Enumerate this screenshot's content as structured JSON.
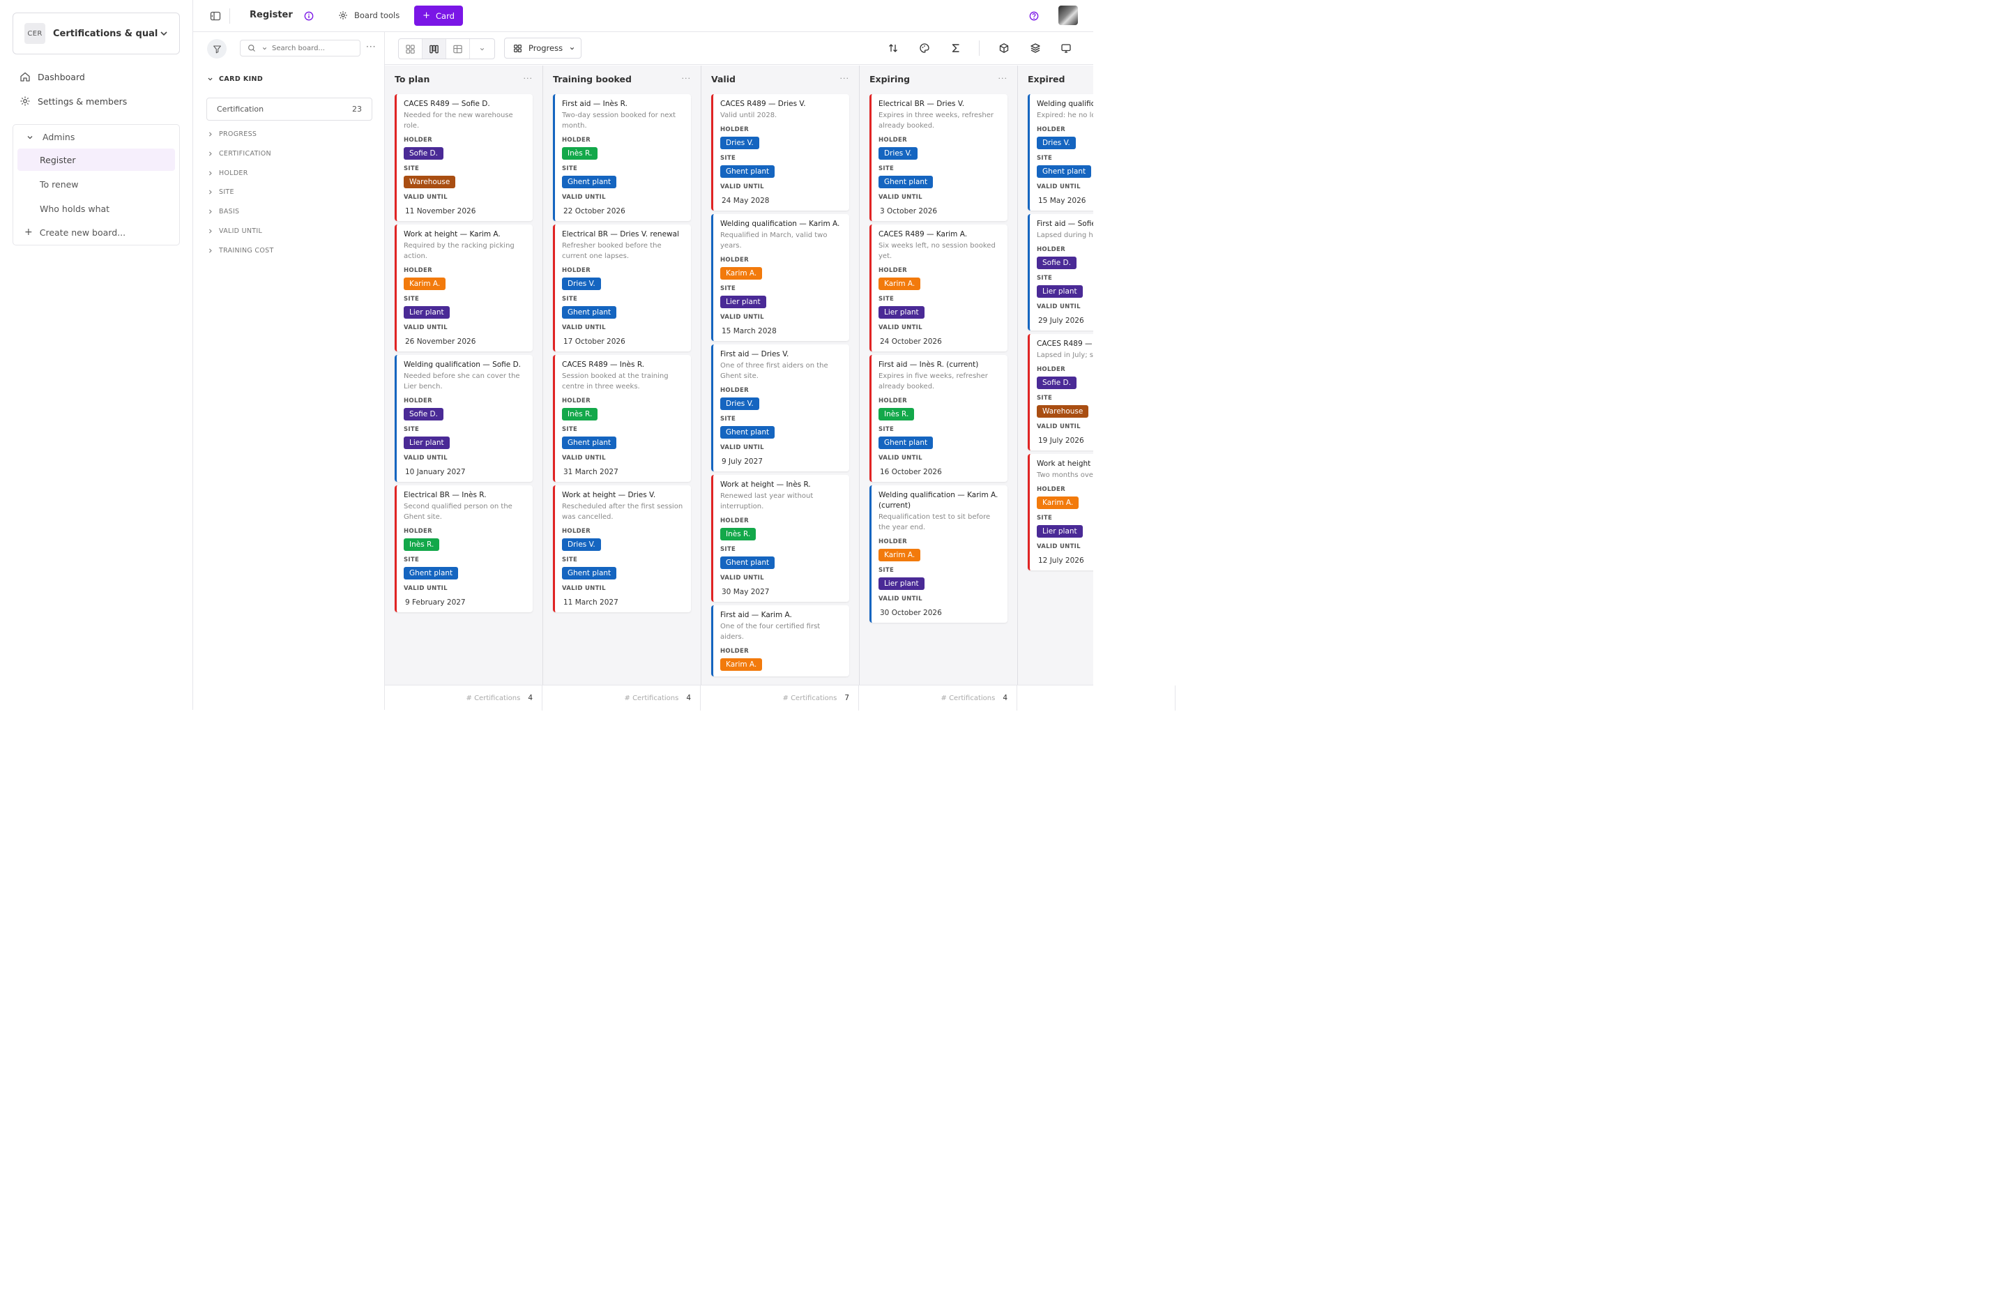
{
  "workspace": {
    "badge": "CER",
    "name": "Certifications & quali..."
  },
  "nav": {
    "dashboard": "Dashboard",
    "settings": "Settings & members"
  },
  "boards": {
    "group": "Admins",
    "items": [
      "Register",
      "To renew",
      "Who holds what"
    ],
    "create": "Create new board..."
  },
  "topbar": {
    "title": "Register",
    "board_tools": "Board tools",
    "card_button": "Card"
  },
  "filter": {
    "search_placeholder": "Search board...",
    "card_kind": "CARD KIND",
    "kind_value": "Certification",
    "kind_count": "23",
    "groups": [
      "PROGRESS",
      "CERTIFICATION",
      "HOLDER",
      "SITE",
      "BASIS",
      "VALID UNTIL",
      "TRAINING COST"
    ]
  },
  "view": {
    "group_by": "Progress"
  },
  "labels": {
    "holder": "HOLDER",
    "site": "SITE",
    "valid_until": "VALID UNTIL"
  },
  "colors": {
    "accent": "#7a16e6",
    "stripe_red": "#e02424",
    "stripe_blue": "#1565c0"
  },
  "columns": [
    {
      "title": "To plan",
      "footer_label": "# Certifications",
      "footer_count": "4",
      "cards": [
        {
          "title": "CACES R489 — Sofie D.",
          "desc": "Needed for the new warehouse role.",
          "holder": "Sofie D.",
          "site": "Warehouse",
          "valid_until": "11 November 2026",
          "stripe": "red"
        },
        {
          "title": "Work at height — Karim A.",
          "desc": "Required by the racking picking action.",
          "holder": "Karim A.",
          "site": "Lier plant",
          "valid_until": "26 November 2026",
          "stripe": "red"
        },
        {
          "title": "Welding qualification — Sofie D.",
          "desc": "Needed before she can cover the Lier bench.",
          "holder": "Sofie D.",
          "site": "Lier plant",
          "valid_until": "10 January 2027",
          "stripe": "blue"
        },
        {
          "title": "Electrical BR — Inès R.",
          "desc": "Second qualified person on the Ghent site.",
          "holder": "Inès R.",
          "site": "Ghent plant",
          "valid_until": "9 February 2027",
          "stripe": "red"
        }
      ]
    },
    {
      "title": "Training booked",
      "footer_label": "# Certifications",
      "footer_count": "4",
      "cards": [
        {
          "title": "First aid — Inès R.",
          "desc": "Two-day session booked for next month.",
          "holder": "Inès R.",
          "site": "Ghent plant",
          "valid_until": "22 October 2026",
          "stripe": "blue"
        },
        {
          "title": "Electrical BR — Dries V. renewal",
          "desc": "Refresher booked before the current one lapses.",
          "holder": "Dries V.",
          "site": "Ghent plant",
          "valid_until": "17 October 2026",
          "stripe": "red"
        },
        {
          "title": "CACES R489 — Inès R.",
          "desc": "Session booked at the training centre in three weeks.",
          "holder": "Inès R.",
          "site": "Ghent plant",
          "valid_until": "31 March 2027",
          "stripe": "red"
        },
        {
          "title": "Work at height — Dries V.",
          "desc": "Rescheduled after the first session was cancelled.",
          "holder": "Dries V.",
          "site": "Ghent plant",
          "valid_until": "11 March 2027",
          "stripe": "red"
        }
      ]
    },
    {
      "title": "Valid",
      "footer_label": "# Certifications",
      "footer_count": "7",
      "cards": [
        {
          "title": "CACES R489 — Dries V.",
          "desc": "Valid until 2028.",
          "holder": "Dries V.",
          "site": "Ghent plant",
          "valid_until": "24 May 2028",
          "stripe": "red"
        },
        {
          "title": "Welding qualification — Karim A.",
          "desc": "Requalified in March, valid two years.",
          "holder": "Karim A.",
          "site": "Lier plant",
          "valid_until": "15 March 2028",
          "stripe": "blue"
        },
        {
          "title": "First aid — Dries V.",
          "desc": "One of three first aiders on the Ghent site.",
          "holder": "Dries V.",
          "site": "Ghent plant",
          "valid_until": "9 July 2027",
          "stripe": "blue"
        },
        {
          "title": "Work at height — Inès R.",
          "desc": "Renewed last year without interruption.",
          "holder": "Inès R.",
          "site": "Ghent plant",
          "valid_until": "30 May 2027",
          "stripe": "red"
        },
        {
          "title": "First aid — Karim A.",
          "desc": "One of the four certified first aiders.",
          "holder": "Karim A.",
          "site": "",
          "valid_until": "",
          "stripe": "blue"
        }
      ]
    },
    {
      "title": "Expiring",
      "footer_label": "# Certifications",
      "footer_count": "4",
      "cards": [
        {
          "title": "Electrical BR — Dries V.",
          "desc": "Expires in three weeks, refresher already booked.",
          "holder": "Dries V.",
          "site": "Ghent plant",
          "valid_until": "3 October 2026",
          "stripe": "red"
        },
        {
          "title": "CACES R489 — Karim A.",
          "desc": "Six weeks left, no session booked yet.",
          "holder": "Karim A.",
          "site": "Lier plant",
          "valid_until": "24 October 2026",
          "stripe": "red"
        },
        {
          "title": "First aid — Inès R. (current)",
          "desc": "Expires in five weeks, refresher already booked.",
          "holder": "Inès R.",
          "site": "Ghent plant",
          "valid_until": "16 October 2026",
          "stripe": "red"
        },
        {
          "title": "Welding qualification — Karim A. (current)",
          "desc": "Requalification test to sit before the year end.",
          "holder": "Karim A.",
          "site": "Lier plant",
          "valid_until": "30 October 2026",
          "stripe": "blue"
        }
      ]
    },
    {
      "title": "Expired",
      "footer_label": "",
      "footer_count": "",
      "cards": [
        {
          "title": "Welding qualific",
          "desc": "Expired: he no lo welded assembl",
          "holder": "Dries V.",
          "site": "Ghent plant",
          "valid_until": "15 May 2026",
          "stripe": "blue"
        },
        {
          "title": "First aid — Sofie",
          "desc": "Lapsed during he replanned.",
          "holder": "Sofie D.",
          "site": "Lier plant",
          "valid_until": "29 July 2026",
          "stripe": "blue"
        },
        {
          "title": "CACES R489 —",
          "desc": "Lapsed in July; sh since.",
          "holder": "Sofie D.",
          "site": "Warehouse",
          "valid_until": "19 July 2026",
          "stripe": "red"
        },
        {
          "title": "Work at height — (lapsed)",
          "desc": "Two months ove interventions.",
          "holder": "Karim A.",
          "site": "Lier plant",
          "valid_until": "12 July 2026",
          "stripe": "red"
        }
      ]
    }
  ]
}
